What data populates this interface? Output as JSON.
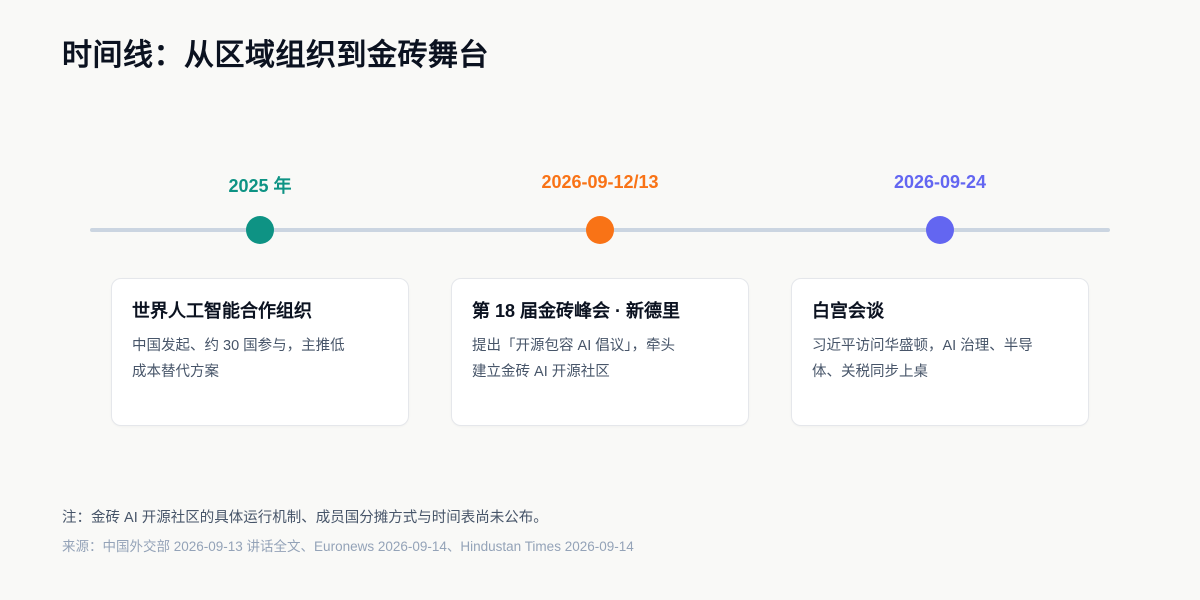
{
  "title": "时间线：从区域组织到金砖舞台",
  "colors": {
    "background": "#F9F9F7",
    "line": "#CBD5E1",
    "teal": "#0E9384",
    "orange": "#F97316",
    "indigo": "#6366F1"
  },
  "events": [
    {
      "date": "2025 年",
      "color": "#0E9384",
      "title": "世界人工智能合作组织",
      "lines": [
        "中国发起、约 30 国参与，主推低",
        "成本替代方案"
      ]
    },
    {
      "date": "2026-09-12/13",
      "color": "#F97316",
      "title": "第 18 届金砖峰会 · 新德里",
      "lines": [
        "提出「开源包容 AI 倡议」，牵头",
        "建立金砖 AI 开源社区"
      ]
    },
    {
      "date": "2026-09-24",
      "color": "#6366F1",
      "title": "白宫会谈",
      "lines": [
        "习近平访问华盛顿，AI 治理、半导",
        "体、关税同步上桌"
      ]
    }
  ],
  "note": "注：金砖 AI 开源社区的具体运行机制、成员国分摊方式与时间表尚未公布。",
  "source": "来源：中国外交部 2026-09-13 讲话全文、Euronews 2026-09-14、Hindustan Times 2026-09-14"
}
